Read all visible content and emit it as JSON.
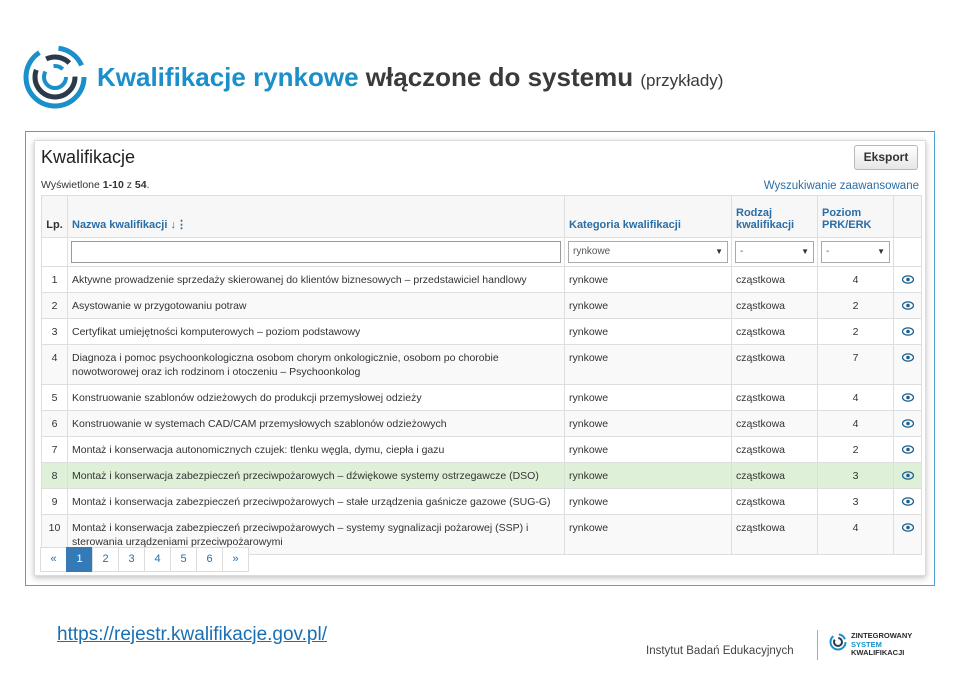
{
  "slide": {
    "title_part1": "Kwalifikacje rynkowe",
    "title_part2": "włączone do systemu",
    "title_part3": "(przykłady)",
    "url": "https://rejestr.kwalifikacje.gov.pl/",
    "institute": "Instytut Badań Edukacyjnych",
    "logo_lines": [
      "ZINTEGROWANY",
      "SYSTEM",
      "KWALIFIKACJI"
    ]
  },
  "panel": {
    "title": "Kwalifikacje",
    "export_label": "Eksport",
    "shown_prefix": "Wyświetlone ",
    "shown_range": "1-10",
    "shown_mid": " z ",
    "shown_total": "54",
    "shown_suffix": ".",
    "advanced_search": "Wyszukiwanie zaawansowane"
  },
  "table": {
    "headers": {
      "lp": "Lp.",
      "name": "Nazwa kwalifikacji",
      "category": "Kategoria kwalifikacji",
      "type": "Rodzaj kwalifikacji",
      "level": "Poziom PRK/ERK"
    },
    "filters": {
      "category": "rynkowe",
      "type": "-",
      "level": "-"
    },
    "rows": [
      {
        "lp": "1",
        "name": "Aktywne prowadzenie sprzedaży skierowanej do klientów biznesowych – przedstawiciel handlowy",
        "category": "rynkowe",
        "type": "cząstkowa",
        "level": "4"
      },
      {
        "lp": "2",
        "name": "Asystowanie w przygotowaniu potraw",
        "category": "rynkowe",
        "type": "cząstkowa",
        "level": "2"
      },
      {
        "lp": "3",
        "name": "Certyfikat umiejętności komputerowych – poziom podstawowy",
        "category": "rynkowe",
        "type": "cząstkowa",
        "level": "2"
      },
      {
        "lp": "4",
        "name": "Diagnoza i pomoc psychoonkologiczna osobom chorym onkologicznie, osobom po chorobie nowotworowej oraz ich rodzinom i otoczeniu – Psychoonkolog",
        "category": "rynkowe",
        "type": "cząstkowa",
        "level": "7"
      },
      {
        "lp": "5",
        "name": "Konstruowanie szablonów odzieżowych do produkcji przemysłowej odzieży",
        "category": "rynkowe",
        "type": "cząstkowa",
        "level": "4"
      },
      {
        "lp": "6",
        "name": "Konstruowanie w systemach CAD/CAM przemysłowych szablonów odzieżowych",
        "category": "rynkowe",
        "type": "cząstkowa",
        "level": "4"
      },
      {
        "lp": "7",
        "name": "Montaż i konserwacja autonomicznych czujek: tlenku węgla, dymu, ciepła i gazu",
        "category": "rynkowe",
        "type": "cząstkowa",
        "level": "2"
      },
      {
        "lp": "8",
        "name": "Montaż i konserwacja zabezpieczeń przeciwpożarowych – dźwiękowe systemy ostrzegawcze (DSO)",
        "category": "rynkowe",
        "type": "cząstkowa",
        "level": "3"
      },
      {
        "lp": "9",
        "name": "Montaż i konserwacja zabezpieczeń przeciwpożarowych – stałe urządzenia gaśnicze gazowe (SUG-G)",
        "category": "rynkowe",
        "type": "cząstkowa",
        "level": "3"
      },
      {
        "lp": "10",
        "name": "Montaż i konserwacja zabezpieczeń przeciwpożarowych – systemy sygnalizacji pożarowej (SSP) i sterowania urządzeniami przeciwpożarowymi",
        "category": "rynkowe",
        "type": "cząstkowa",
        "level": "4"
      }
    ]
  },
  "pagination": {
    "prev": "«",
    "pages": [
      "1",
      "2",
      "3",
      "4",
      "5",
      "6"
    ],
    "next": "»",
    "active": "1"
  },
  "colors": {
    "brand_blue": "#1a8fc9",
    "link_blue": "#2a6ea6",
    "highlight_row": "#dff0d8",
    "active_page": "#337ab7"
  },
  "icons": {
    "sort": "sort-icon",
    "view": "eye-icon",
    "select_caret": "caret-down-icon"
  }
}
